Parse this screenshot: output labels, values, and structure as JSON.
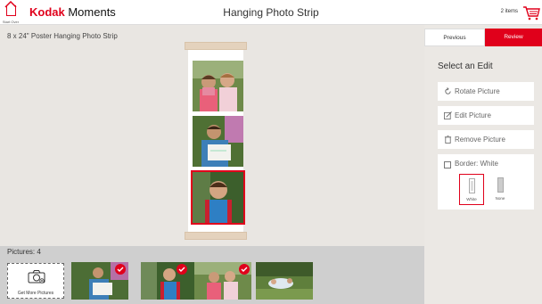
{
  "header": {
    "start_over": "Start Over",
    "brand_bold": "Kodak",
    "brand_rest": " Moments",
    "title": "Hanging Photo Strip",
    "cart_count": "2 items"
  },
  "product": {
    "title": "8 x 24\" Poster Hanging Photo Strip"
  },
  "nav": {
    "previous": "Previous",
    "review": "Review"
  },
  "edit": {
    "heading": "Select an Edit",
    "options": [
      {
        "label": "Rotate Picture",
        "icon": "rotate-icon"
      },
      {
        "label": "Edit Picture",
        "icon": "edit-icon"
      },
      {
        "label": "Remove Picture",
        "icon": "trash-icon"
      }
    ],
    "border_label": "Border: White",
    "border_choices": [
      {
        "label": "White",
        "selected": true
      },
      {
        "label": "None",
        "selected": false
      }
    ]
  },
  "pictures": {
    "count_label": "Pictures: 4",
    "get_more": "Get More Pictures"
  },
  "colors": {
    "accent": "#e0001b",
    "background": "#e9e6e2"
  }
}
